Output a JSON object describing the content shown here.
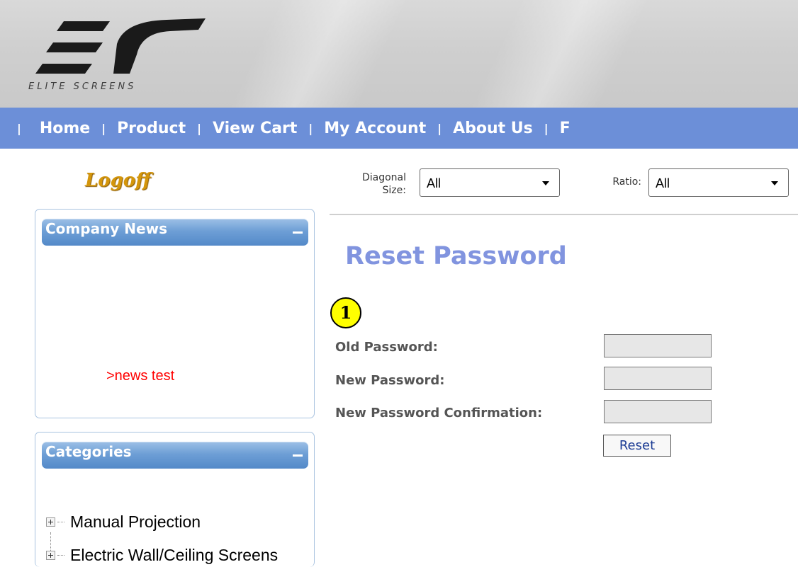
{
  "header": {
    "brand_text": "ELITE SCREENS",
    "colors": {
      "nav_bg": "#6c8fd8",
      "title": "#8194df",
      "news_link": "#ff0000",
      "logoff": "#d4960b",
      "step_badge": "#ffff00"
    }
  },
  "nav": {
    "separator": "|",
    "items": [
      {
        "label": "Home"
      },
      {
        "label": "Product"
      },
      {
        "label": "View Cart"
      },
      {
        "label": "My Account"
      },
      {
        "label": "About Us"
      },
      {
        "label": "F"
      }
    ]
  },
  "sidebar": {
    "logoff_label": "Logoff",
    "news_panel": {
      "title": "Company News",
      "items": [
        {
          "label": ">news test"
        }
      ]
    },
    "categories_panel": {
      "title": "Categories",
      "items": [
        {
          "label": "Manual Projection"
        },
        {
          "label": "Electric Wall/Ceiling Screens"
        }
      ]
    }
  },
  "filters": {
    "diagonal": {
      "label_line1": "Diagonal",
      "label_line2": "Size:",
      "selected": "All"
    },
    "ratio": {
      "label": "Ratio:",
      "selected": "All"
    }
  },
  "main": {
    "title": "Reset Password",
    "step_badge": "1",
    "form": {
      "old_password_label": "Old Password:",
      "new_password_label": "New Password:",
      "confirm_label": "New Password Confirmation:",
      "submit_label": "Reset"
    }
  }
}
